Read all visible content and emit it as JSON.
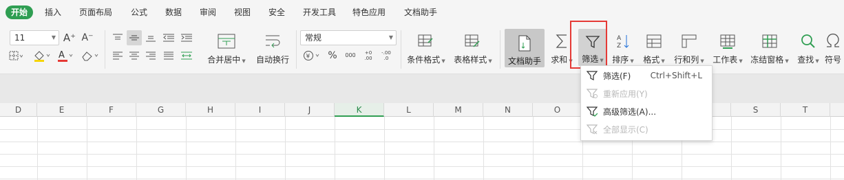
{
  "menu": {
    "tabs": [
      "开始",
      "插入",
      "页面布局",
      "公式",
      "数据",
      "审阅",
      "视图",
      "安全",
      "开发工具",
      "特色应用",
      "文档助手"
    ],
    "active": "开始"
  },
  "ribbon": {
    "font_size": "11",
    "number_format": "常规",
    "font_grow": "A⁺",
    "font_shrink": "A⁻",
    "percent": "%",
    "thousands": "000",
    "dec_inc": "+0 .00",
    "dec_dec": "-.00 .0",
    "merge_center": "合并居中",
    "wrap_text": "自动换行",
    "cond_format": "条件格式",
    "table_style": "表格样式",
    "doc_assistant": "文档助手",
    "sum": "求和",
    "filter": "筛选",
    "sort": "排序",
    "format": "格式",
    "row_col": "行和列",
    "worksheet": "工作表",
    "freeze": "冻结窗格",
    "find": "查找",
    "symbol": "符号"
  },
  "sheet": {
    "columns": [
      "D",
      "E",
      "F",
      "G",
      "H",
      "I",
      "J",
      "K",
      "L",
      "M",
      "N",
      "O",
      "",
      "",
      "",
      "S",
      "T"
    ],
    "selected_column": "K"
  },
  "filter_menu": {
    "items": [
      {
        "label": "筛选(F)",
        "shortcut": "Ctrl+Shift+L",
        "enabled": true
      },
      {
        "label": "重新应用(Y)",
        "shortcut": "",
        "enabled": false
      },
      {
        "label": "高级筛选(A)...",
        "shortcut": "",
        "enabled": true
      },
      {
        "label": "全部显示(C)",
        "shortcut": "",
        "enabled": false
      }
    ]
  },
  "colors": {
    "accent_green": "#2f9e52",
    "highlight_red": "#e53935"
  }
}
